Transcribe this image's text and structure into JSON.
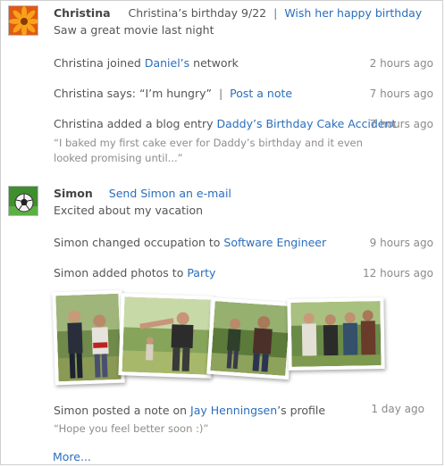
{
  "feed": {
    "christina": {
      "name": "Christina",
      "status_prefix": "Christina’s birthday 9/22",
      "divider": "|",
      "action": "Wish her happy birthday",
      "status": "Saw a great movie last night",
      "items": [
        {
          "prefix": "Christina joined ",
          "link": "Daniel’s",
          "suffix": " network",
          "time": "2 hours ago"
        },
        {
          "prefix": "Christina says: “I’m hungry”",
          "divider": "|",
          "link": "Post a note",
          "time": "7 hours ago"
        },
        {
          "prefix": "Christina added a blog entry ",
          "link": "Daddy’s Birthday Cake Accident",
          "time": "7 hours ago",
          "quote": "“I baked my first cake ever for Daddy’s birthday and it even looked promising until...”"
        }
      ]
    },
    "simon": {
      "name": "Simon",
      "action": "Send Simon an e-mail",
      "status": "Excited about my vacation",
      "items": [
        {
          "prefix": "Simon changed occupation to ",
          "link": "Software Engineer",
          "time": "9 hours ago"
        },
        {
          "prefix": "Simon added photos to ",
          "link": "Party",
          "time": "12 hours ago"
        },
        {
          "prefix": "Simon posted a note on ",
          "link": "Jay Henningsen",
          "suffix": "’s profile",
          "time": "1 day ago",
          "quote": "“Hope you feel better soon :)”"
        }
      ]
    },
    "more_label": "More...",
    "colors": {
      "link": "#2a6ebc",
      "text": "#555555",
      "time": "#8a8a8a"
    }
  }
}
